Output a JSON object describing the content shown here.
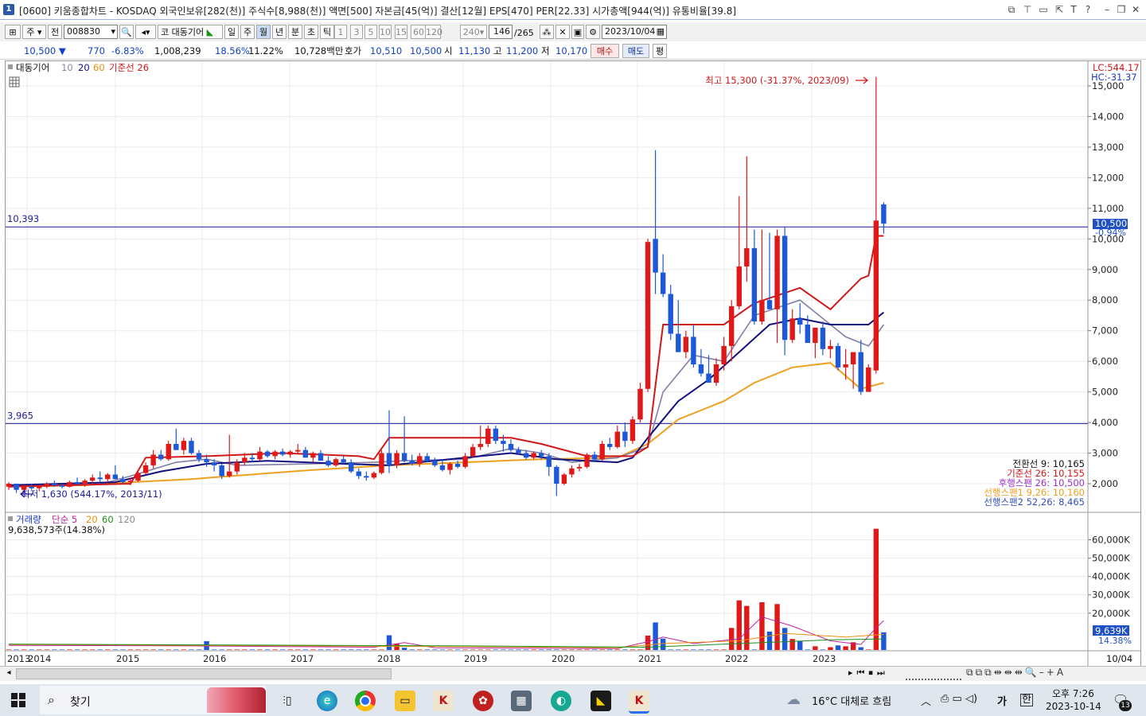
{
  "window": {
    "title": "[0600] 키움종합차트 - KOSDAQ 외국인보유[282(천)] 주식수[8,988(천)] 액면[500] 자본금[45(억)] 결산[12월] EPS[470] PER[22.33] 시가총액[944(억)] 유통비율[39.8]",
    "app_icon": "1",
    "buttons": [
      "restore-icon",
      "pin-icon",
      "window-icon",
      "maximize-small-icon",
      "text-icon",
      "help-icon",
      "minimize-icon",
      "restore-down-icon",
      "close-icon"
    ],
    "button_glyphs": [
      "⧉",
      "⊤",
      "▭",
      "⇱",
      "T",
      "?",
      "–",
      "❐",
      "✕"
    ]
  },
  "toolbar": {
    "market_sel": "주",
    "prefix": "전",
    "code": "008830",
    "name": "대동기어",
    "periods": [
      "일",
      "주",
      "월",
      "년",
      "분",
      "초",
      "틱"
    ],
    "active_period": "월",
    "intervals": [
      "1",
      "3",
      "5",
      "10",
      "15",
      "60",
      "120",
      "240"
    ],
    "interval_combo": "240",
    "count": "146",
    "count_total": "/265",
    "date": "2023/10/04"
  },
  "quote": {
    "price": "10,500 ▼",
    "change": "770",
    "change_pct": "-6.83%",
    "volume": "1,008,239",
    "turnover_pct": "18.56%",
    "extra_pct": "11.22%",
    "amount": "10,728백만",
    "hoga_label": "호가",
    "ask": "10,510",
    "bid": "10,500",
    "open_label": "시",
    "open": "11,130",
    "high_label": "고",
    "high": "11,200",
    "low_label": "저",
    "low": "10,170",
    "buy_btn": "매수",
    "sell_btn": "매도",
    "eval_btn": "평"
  },
  "price_panel": {
    "legend": {
      "name": "대동기어",
      "ma1": "10",
      "ma2": "20",
      "ma3": "60",
      "base": "기준선 26"
    },
    "y_labels": [
      "15,000",
      "14,000",
      "13,000",
      "12,000",
      "11,000",
      "10,000",
      "9,000",
      "8,000",
      "7,000",
      "6,000",
      "5,000",
      "4,000",
      "3,000",
      "2,000"
    ],
    "lc": "LC:544.17",
    "hc": "HC:-31.37",
    "hline1": "10,393",
    "hline2": "3,965",
    "current_price": "10,500",
    "current_pct": "-0.94%",
    "max_note": "최고 15,300 (-31.37%, 2023/09)",
    "min_note": "최저 1,630 (544.17%, 2013/11)",
    "ichimoku": [
      {
        "text": "전환선 9: 10,165",
        "color": "#111111"
      },
      {
        "text": "기준선 26: 10,155",
        "color": "#d01818"
      },
      {
        "text": "후행스팬 26: 10,500",
        "color": "#9b30c8"
      },
      {
        "text": "선행스팬1 9,26: 10,160",
        "color": "#f0a020"
      },
      {
        "text": "선행스팬2 52,26: 8,465",
        "color": "#3050c0"
      }
    ]
  },
  "volume_panel": {
    "legend": {
      "name": "거래량",
      "ma5": "단순 5",
      "ma20": "20",
      "ma60": "60",
      "ma120": "120"
    },
    "info": "9,638,573주(14.38%)",
    "y_labels": [
      "60,000K",
      "50,000K",
      "40,000K",
      "30,000K",
      "20,000K"
    ],
    "current": "9,639K",
    "current_pct": "14.38%"
  },
  "x_axis": {
    "labels": [
      "2013",
      "2014",
      "2015",
      "2016",
      "2017",
      "2018",
      "2019",
      "2020",
      "2021",
      "2022",
      "2023"
    ],
    "right_label": "10/04"
  },
  "chart_data": [
    {
      "type": "candlestick",
      "title": "대동기어",
      "x_labels": [
        "2013",
        "2014",
        "2015",
        "2016",
        "2017",
        "2018",
        "2019",
        "2020",
        "2021",
        "2022",
        "2023"
      ],
      "ylim": [
        1500,
        15500
      ],
      "key_points": [
        {
          "date": "2013/11",
          "low": 1630
        },
        {
          "date": "2023/09",
          "high": 15300
        },
        {
          "date": "2023/10",
          "open": 11130,
          "high": 11200,
          "low": 10170,
          "close": 10500
        }
      ],
      "hlines": [
        10393,
        3965
      ]
    },
    {
      "type": "bar",
      "title": "거래량",
      "unit": "K",
      "ylim": [
        0,
        68000
      ],
      "current": 9639
    }
  ],
  "taskbar": {
    "search": "찾기",
    "weather": "16°C 대체로 흐림",
    "ime1": "가",
    "ime2": "한",
    "time": "오후 7:26",
    "date": "2023-10-14",
    "notif": "13"
  }
}
